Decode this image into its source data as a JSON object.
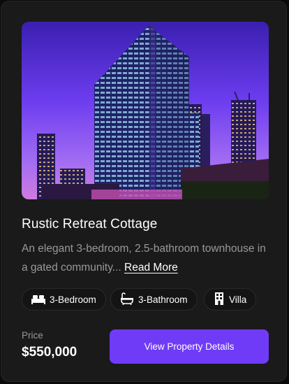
{
  "card": {
    "title": "Rustic Retreat Cottage",
    "description": "An elegant 3-bedroom, 2.5-bathroom townhouse in a gated community...",
    "read_more_label": "Read More",
    "features": [
      {
        "label": "3-Bedroom",
        "icon": "bed-icon"
      },
      {
        "label": "3-Bathroom",
        "icon": "bathtub-icon"
      },
      {
        "label": "Villa",
        "icon": "building-icon"
      }
    ],
    "price_label": "Price",
    "price": "$550,000",
    "cta_label": "View Property Details"
  },
  "colors": {
    "accent": "#703bf7",
    "card_background": "#1a1a1a",
    "muted_text": "#999999"
  }
}
